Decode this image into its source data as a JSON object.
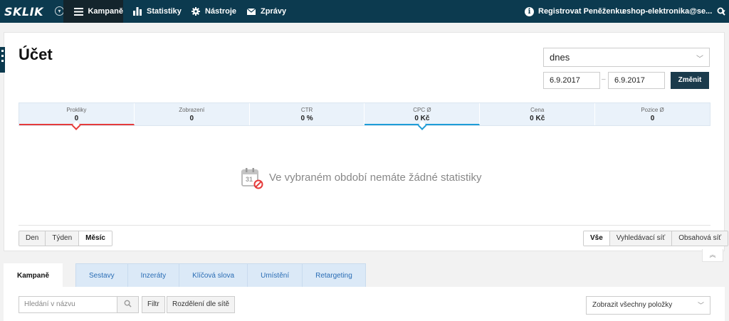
{
  "topbar": {
    "logo": "SKLIK",
    "nav": [
      {
        "label": "Kampaně",
        "icon": "hamburger-icon"
      },
      {
        "label": "Statistiky",
        "icon": "bar-chart-icon"
      },
      {
        "label": "Nástroje",
        "icon": "gear-icon"
      },
      {
        "label": "Zprávy",
        "icon": "envelope-icon"
      }
    ],
    "wallet_label": "Registrovat Peněženku",
    "account_label": "eshop-elektronika@se...",
    "search_icon": "search-icon"
  },
  "main": {
    "title": "Účet",
    "period_select": "dnes",
    "date_from": "6.9.2017",
    "date_to": "6.9.2017",
    "date_separator": "–",
    "change_button": "Změnit",
    "stats": [
      {
        "label": "Prokliky",
        "value": "0"
      },
      {
        "label": "Zobrazení",
        "value": "0"
      },
      {
        "label": "CTR",
        "value": "0 %"
      },
      {
        "label": "CPC Ø",
        "value": "0 Kč"
      },
      {
        "label": "Cena",
        "value": "0 Kč"
      },
      {
        "label": "Pozice Ø",
        "value": "0"
      }
    ],
    "empty_message": "Ve vybraném období nemáte žádné statistiky",
    "calendar_day": "31",
    "granularity": [
      "Den",
      "Týden",
      "Měsíc"
    ],
    "granularity_selected": "Měsíc",
    "network": [
      "Vše",
      "Vyhledávací síť",
      "Obsahová síť"
    ],
    "network_selected": "Vše"
  },
  "tabs": [
    "Kampaně",
    "Sestavy",
    "Inzeráty",
    "Klíčová slova",
    "Umístění",
    "Retargeting"
  ],
  "toolbar": {
    "search_placeholder": "Hledání v názvu",
    "filter_button": "Filtr",
    "split_button": "Rozdělení dle sítě",
    "show_select": "Zobrazit všechny položky"
  },
  "colors": {
    "topbar": "#0c3a4f",
    "accent_red": "#e53b3b",
    "accent_blue": "#1e9cd7",
    "tab_blue": "#2a6db5"
  }
}
